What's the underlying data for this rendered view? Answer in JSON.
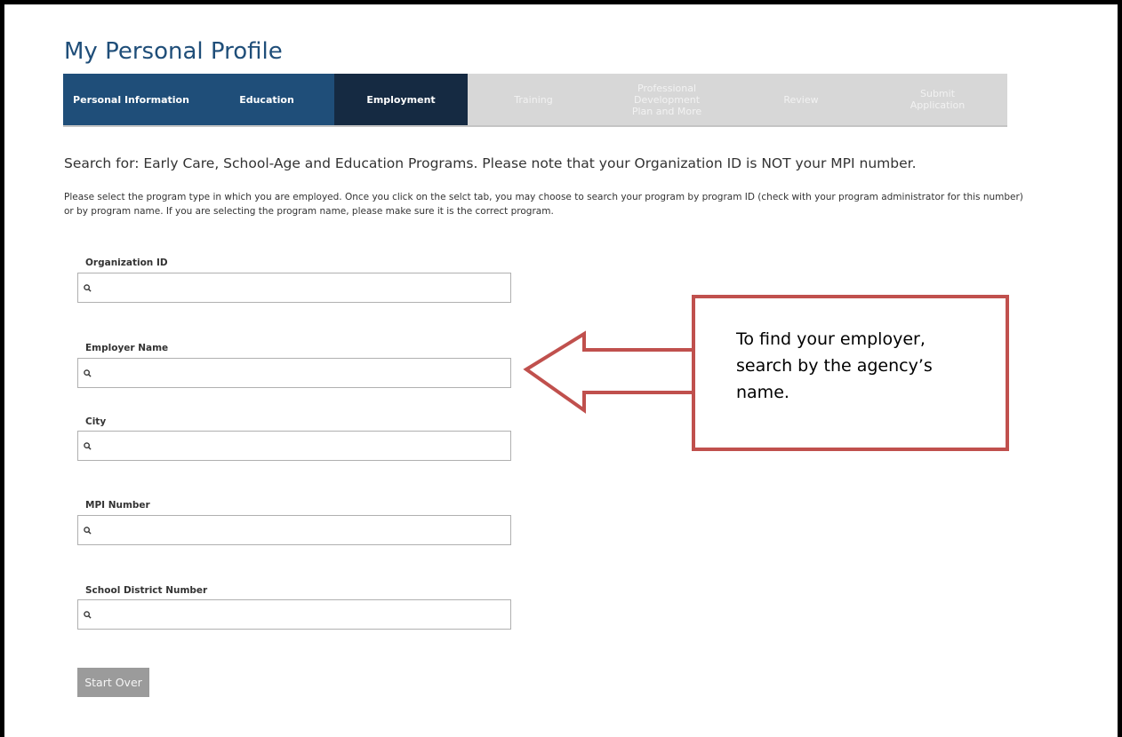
{
  "page": {
    "title": "My Personal Profile"
  },
  "steps": [
    {
      "label": "Personal Information",
      "state": "done"
    },
    {
      "label": "Education",
      "state": "done"
    },
    {
      "label": "Employment",
      "state": "active"
    },
    {
      "label": "Training",
      "state": "pending"
    },
    {
      "label": "Professional Development Plan and More",
      "state": "pending"
    },
    {
      "label": "Review",
      "state": "pending"
    },
    {
      "label": "Submit Application",
      "state": "pending"
    }
  ],
  "search": {
    "heading": "Search for: Early Care, School-Age and Education Programs. Please note that your Organization ID is NOT your MPI number.",
    "instructions": "Please select the program type in which you are employed. Once you click on the selct tab, you may choose to search your program by program ID (check with your program administrator for this number) or by program name. If you are selecting the program name, please make sure it is the correct program."
  },
  "fields": {
    "organization_id": {
      "label": "Organization ID",
      "value": ""
    },
    "employer_name": {
      "label": "Employer Name",
      "value": ""
    },
    "city": {
      "label": "City",
      "value": ""
    },
    "mpi_number": {
      "label": "MPI Number",
      "value": ""
    },
    "school_district_number": {
      "label": "School District Number",
      "value": ""
    }
  },
  "buttons": {
    "start_over": "Start Over"
  },
  "callout": {
    "text": "To find your employer, search by the agency’s name."
  },
  "colors": {
    "brand_blue": "#1f4e79",
    "active_step": "#152a42",
    "pending_step": "#d7d7d7",
    "callout_red": "#c0504d",
    "button_gray": "#9b9b9b"
  },
  "icons": {
    "field_icon": "search-icon",
    "annotation": "arrow-left-icon"
  }
}
